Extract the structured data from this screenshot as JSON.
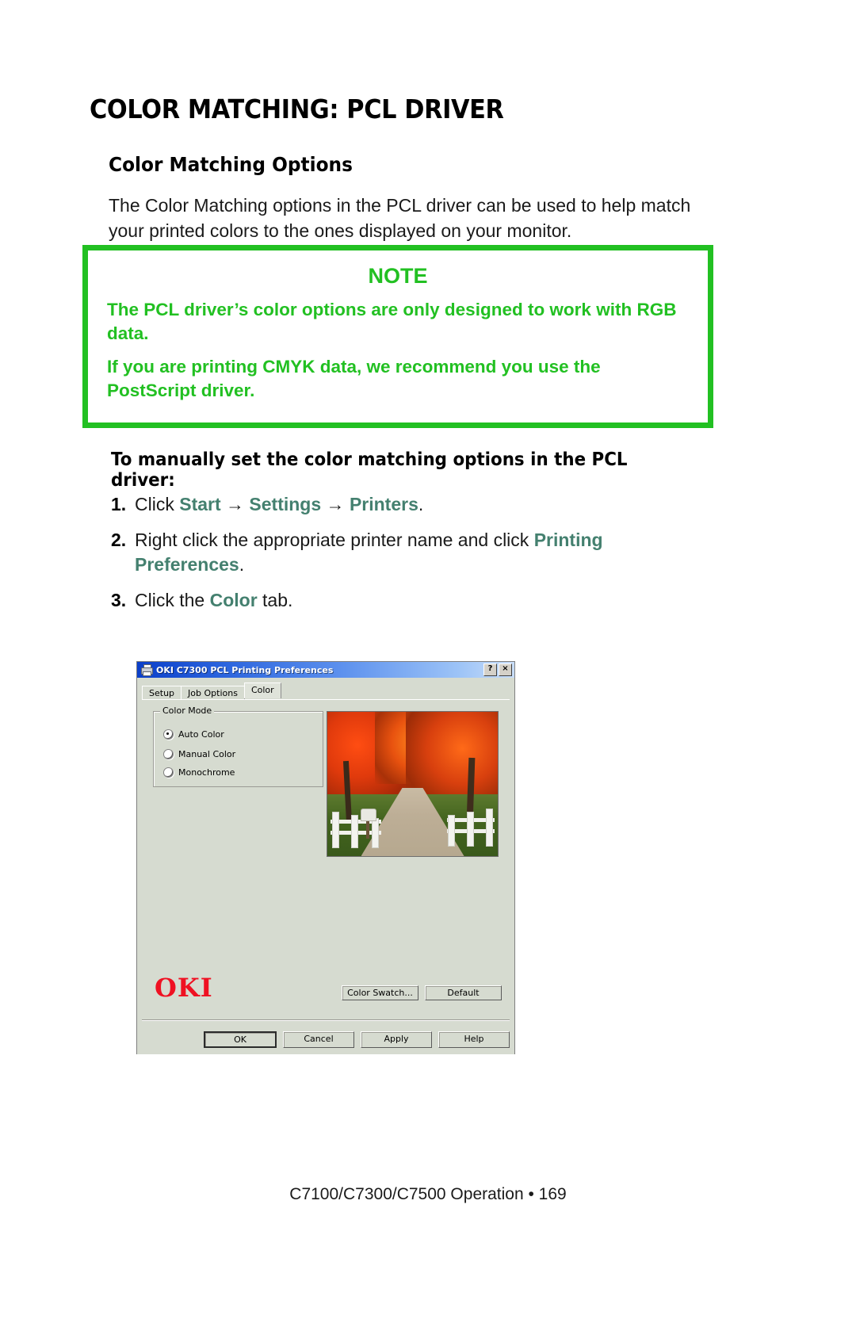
{
  "page": {
    "title": "COLOR MATCHING: PCL DRIVER",
    "section_heading": "Color Matching Options",
    "intro_paragraph": "The Color Matching options in the PCL driver can be used to help match your printed colors to the ones displayed on your monitor.",
    "footer": "C7100/C7300/C7500  Operation • 169"
  },
  "note": {
    "title": "NOTE",
    "paragraph_1": "The PCL driver’s color options are only designed to work with RGB data.",
    "paragraph_2": "If you are printing CMYK data, we recommend you use the PostScript driver.",
    "border_color": "#22c022",
    "text_color": "#22c022"
  },
  "instructions": {
    "heading": "To manually set the color matching options in the PCL driver:",
    "link_color": "#44806f",
    "steps": [
      {
        "number": "1.",
        "parts": [
          {
            "text": "Click ",
            "style": "plain"
          },
          {
            "text": "Start",
            "style": "link"
          },
          {
            "text": " → ",
            "style": "plain"
          },
          {
            "text": "Settings",
            "style": "link"
          },
          {
            "text": " → ",
            "style": "plain"
          },
          {
            "text": "Printers",
            "style": "link"
          },
          {
            "text": ".",
            "style": "plain"
          }
        ]
      },
      {
        "number": "2.",
        "parts": [
          {
            "text": "Right click the appropriate printer name and click ",
            "style": "plain"
          },
          {
            "text": "Printing Preferences",
            "style": "link"
          },
          {
            "text": ".",
            "style": "plain"
          }
        ]
      },
      {
        "number": "3.",
        "parts": [
          {
            "text": "Click the ",
            "style": "plain"
          },
          {
            "text": "Color",
            "style": "link"
          },
          {
            "text": " tab.",
            "style": "plain"
          }
        ]
      }
    ]
  },
  "dialog": {
    "title": "OKI C7300 PCL Printing Preferences",
    "title_icon": "printer-icon",
    "caption_buttons": [
      "?",
      "×"
    ],
    "tabs": [
      {
        "label": "Setup",
        "active": false
      },
      {
        "label": "Job Options",
        "active": false
      },
      {
        "label": "Color",
        "active": true
      }
    ],
    "group": {
      "label": "Color Mode",
      "options": [
        {
          "label": "Auto Color",
          "selected": true
        },
        {
          "label": "Manual Color",
          "selected": false
        },
        {
          "label": "Monochrome",
          "selected": false
        }
      ]
    },
    "preview": {
      "alt": "autumn-forest-road-photo"
    },
    "brand_logo": "OKI",
    "brand_logo_color": "#ef1122",
    "action_buttons": [
      {
        "label": "Color Swatch...",
        "default": false
      },
      {
        "label": "Default",
        "default": false
      }
    ],
    "footer_buttons": [
      {
        "label": "OK",
        "default": true
      },
      {
        "label": "Cancel",
        "default": false
      },
      {
        "label": "Apply",
        "default": false
      },
      {
        "label": "Help",
        "default": false
      }
    ]
  }
}
